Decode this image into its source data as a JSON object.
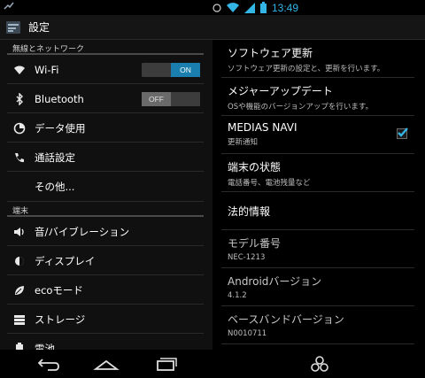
{
  "status_bar": {
    "time": "13:49"
  },
  "action_bar": {
    "title": "設定"
  },
  "left": {
    "sections": [
      {
        "header": "無線とネットワーク"
      },
      {
        "header": "端末"
      }
    ],
    "items": [
      {
        "label": "Wi-Fi",
        "icon": "wifi-icon",
        "toggle": "ON"
      },
      {
        "label": "Bluetooth",
        "icon": "bluetooth-icon",
        "toggle": "OFF"
      },
      {
        "label": "データ使用",
        "icon": "data-usage-icon"
      },
      {
        "label": "通話設定",
        "icon": "phone-icon"
      },
      {
        "label": "その他..."
      },
      {
        "label": "音/バイブレーション",
        "icon": "volume-icon"
      },
      {
        "label": "ディスプレイ",
        "icon": "brightness-icon"
      },
      {
        "label": "ecoモード",
        "icon": "eco-icon"
      },
      {
        "label": "ストレージ",
        "icon": "storage-icon"
      },
      {
        "label": "電池",
        "icon": "battery-icon"
      }
    ]
  },
  "right": {
    "items": [
      {
        "title": "ソフトウェア更新",
        "subtitle": "ソフトウェア更新の設定と、更新を行います。"
      },
      {
        "title": "メジャーアップデート",
        "subtitle": "OSや機能のバージョンアップを行います。"
      },
      {
        "title": "MEDIAS NAVI",
        "subtitle": "更新通知",
        "checked": true
      },
      {
        "title": "端末の状態",
        "subtitle": "電話番号、電池残量など"
      },
      {
        "title": "法的情報"
      },
      {
        "title": "モデル番号",
        "subtitle": "NEC-1213"
      },
      {
        "title": "Androidバージョン",
        "subtitle": "4.1.2"
      },
      {
        "title": "ベースバンドバージョン",
        "subtitle": "N0010711"
      }
    ]
  },
  "colors": {
    "accent": "#33b5e5",
    "toggle_on": "#1a7fae"
  }
}
